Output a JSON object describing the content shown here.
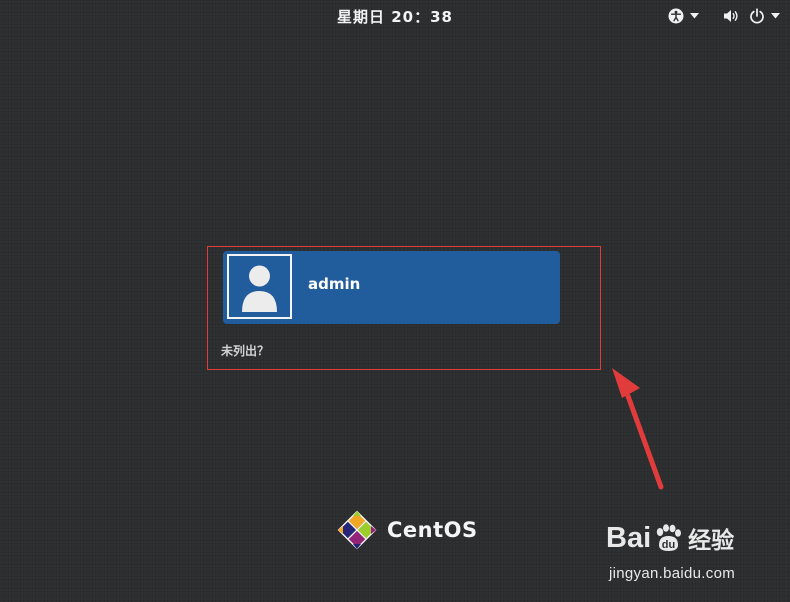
{
  "top_bar": {
    "clock": "星期日 20：38",
    "icons": [
      "accessibility-icon",
      "chevron-down-icon",
      "volume-icon",
      "power-icon",
      "chevron-down-icon"
    ]
  },
  "login": {
    "users": [
      {
        "name": "admin",
        "avatar": "user-avatar-icon"
      }
    ],
    "not_listed_label": "未列出？"
  },
  "branding": {
    "logo": "centos-logo-icon",
    "name": "CentOS"
  },
  "watermark": {
    "brand_left": "Bai",
    "brand_right": "经验",
    "url": "jingyan.baidu.com"
  },
  "colors": {
    "background": "#2d2f31",
    "user_button": "#215d9c",
    "annotation_red": "#e23b3b"
  }
}
